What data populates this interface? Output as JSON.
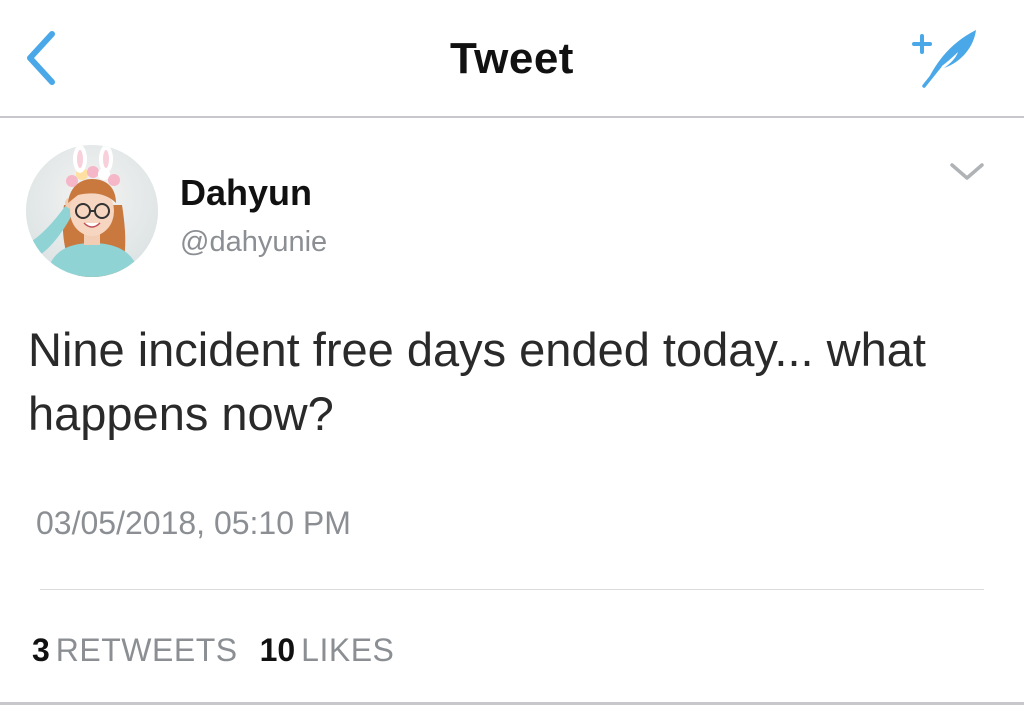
{
  "navbar": {
    "title": "Tweet",
    "back_icon": "chevron-left-icon",
    "compose_icon": "compose-feather-icon"
  },
  "tweet": {
    "author": {
      "name": "Dahyun",
      "handle": "@dahyunie",
      "avatar_icon": "profile-avatar"
    },
    "text": "Nine incident free days ended today... what happens now?",
    "timestamp": "03/05/2018, 05:10 PM",
    "stats": {
      "retweets_count": "3",
      "retweets_label": "RETWEETS",
      "likes_count": "10",
      "likes_label": "LIKES"
    }
  },
  "colors": {
    "accent": "#4aa8e8",
    "text": "#111111",
    "secondary": "#8b8f93",
    "divider": "#c8c8cc"
  }
}
